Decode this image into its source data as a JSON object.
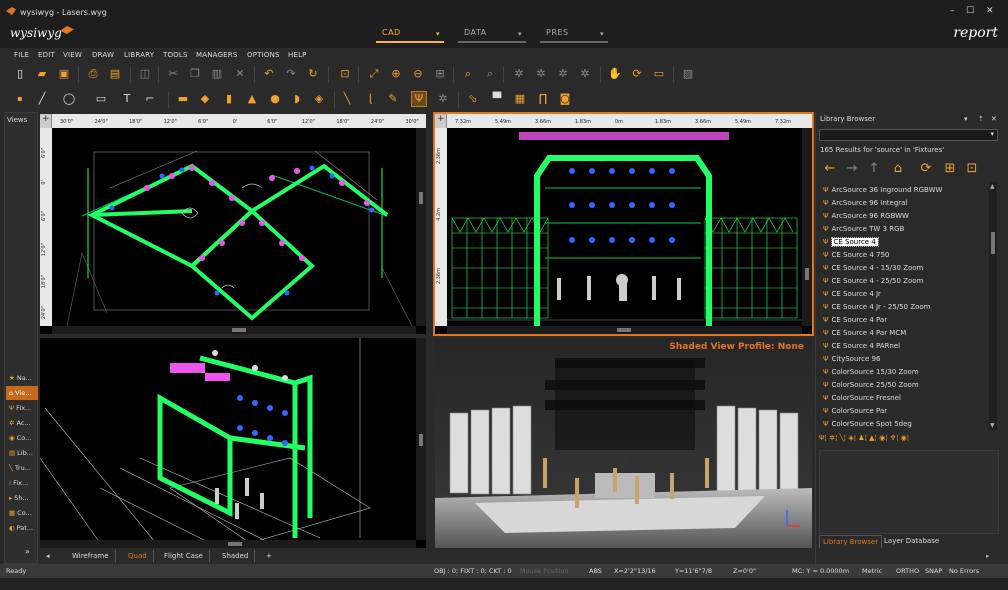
{
  "window": {
    "title": "wysiwyg - Lasers.wyg",
    "minimize": "–",
    "maximize": "☐",
    "close": "✕"
  },
  "modebar": {
    "brand": "wysiwyg",
    "modes": [
      {
        "label": "CAD"
      },
      {
        "label": "DATA"
      },
      {
        "label": "PRES"
      }
    ],
    "caret": "▾",
    "report": "report"
  },
  "menu": [
    "FILE",
    "EDIT",
    "VIEW",
    "DRAW",
    "LIBRARY",
    "TOOLS",
    "MANAGERS",
    "OPTIONS",
    "HELP"
  ],
  "views_panel": {
    "header": "Views",
    "items": [
      {
        "icon": "★",
        "label": "Na..."
      },
      {
        "icon": "⌂",
        "label": "Vie..."
      },
      {
        "icon": "Ψ",
        "label": "Fix..."
      },
      {
        "icon": "✲",
        "label": "Ac..."
      },
      {
        "icon": "◉",
        "label": "Co..."
      },
      {
        "icon": "▤",
        "label": "Lib..."
      },
      {
        "icon": "╲",
        "label": "Tru..."
      },
      {
        "icon": "⁞",
        "label": "Fix..."
      },
      {
        "icon": "▸",
        "label": "Sh..."
      },
      {
        "icon": "▦",
        "label": "Co..."
      },
      {
        "icon": "◐",
        "label": "Pat..."
      }
    ],
    "expand": "»"
  },
  "viewports": {
    "top_left": {
      "ruler_h": [
        "30'0\"",
        "24'0\"",
        "18'0\"",
        "12'0\"",
        "6'0\"",
        "0'",
        "6'0\"",
        "12'0\"",
        "18'0\"",
        "24'0\"",
        "30'0\""
      ],
      "ruler_v": [
        "6'0\"",
        "0'",
        "6'0\"",
        "12'0\"",
        "18'0\"",
        "24'0\""
      ]
    },
    "top_right": {
      "ruler_h": [
        "7.32m",
        "5.49m",
        "3.66m",
        "1.83m",
        "0m",
        "1.83m",
        "3.66m",
        "5.49m",
        "7.32m"
      ],
      "ruler_v": [
        "2.36m",
        "4.2m",
        "2.36m"
      ]
    },
    "bottom_right": {
      "profile": "Shaded View Profile: None"
    }
  },
  "tabs": {
    "nav": "◂",
    "items": [
      "Wireframe",
      "Quad",
      "Flight Case",
      "Shaded"
    ],
    "add": "+",
    "right": "▸"
  },
  "library": {
    "header": "Library Browser",
    "header_icons": [
      "▾",
      "⇡",
      "✕"
    ],
    "search_value": "",
    "dropdown": "▾",
    "result_text": "165 Results for 'source' in 'Fixtures'",
    "nav_icons": [
      "←",
      "→",
      "↑",
      "⌂",
      "⟳",
      "⊞",
      "⊡"
    ],
    "items": [
      "ArcSource 36 Inground RGBWW",
      "ArcSource 96 Integral",
      "ArcSource 96 RGBWW",
      "ArcSource TW 3 RGB",
      "CE Source 4",
      "CE Source 4 750",
      "CE Source 4 - 15/30 Zoom",
      "CE Source 4 - 25/50 Zoom",
      "CE Source 4 Jr",
      "CE Source 4 Jr - 25/50 Zoom",
      "CE Source 4 Par",
      "CE Source 4 Par MCM",
      "CE Source 4 PARnel",
      "CitySource 96",
      "ColorSource 15/30 Zoom",
      "ColorSource 25/50 Zoom",
      "ColorSource Fresnel",
      "ColorSource Par",
      "ColorSource Spot 5deg"
    ],
    "selected_index": 4,
    "item_icon": "Ψ",
    "filter_icons": "Ψ¦ ✲¦ ╲¦ ◈¦ ♟¦ ▲¦ ◉¦ ♆¦ ◉¦",
    "bottom_tabs": [
      "Library Browser",
      "Layer Database"
    ],
    "expand": "▸"
  },
  "status": {
    "ready": "Ready",
    "counts": "OBJ : 0; FIXT : 0; CKT : 0",
    "dim": "Mouse Position",
    "abs": "ABS",
    "x": "X=2'2\"13/16",
    "y": "Y=11'6\"7/8",
    "z": "Z=0'0\"",
    "mc": "MC: Y = 0.0000m",
    "metric": "Metric",
    "ortho": "ORTHO",
    "snap": "SNAP",
    "errors": "No Errors"
  }
}
